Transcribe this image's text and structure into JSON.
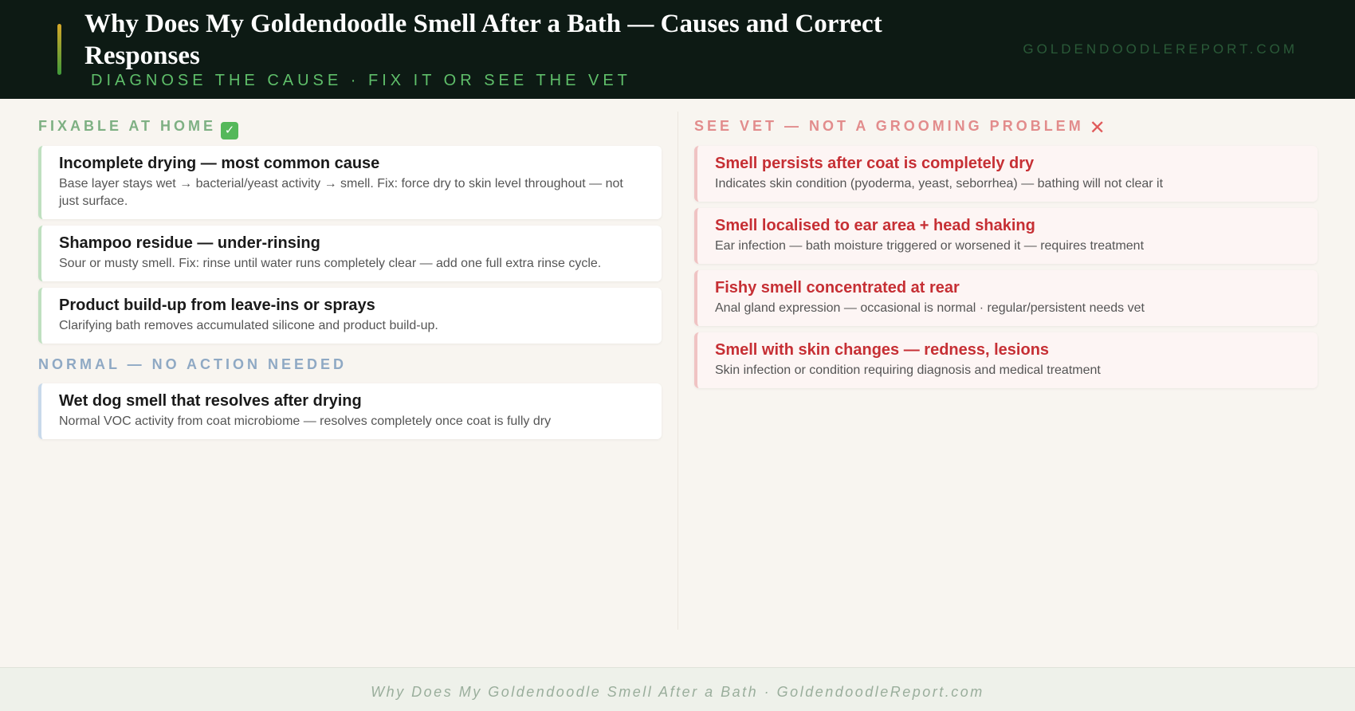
{
  "header": {
    "title": "Why Does My Goldendoodle Smell After a Bath — Causes and Correct Responses",
    "subtitle": "DIAGNOSE THE CAUSE · FIX IT OR SEE THE VET",
    "site": "GOLDENDOODLEREPORT.COM"
  },
  "colors": {
    "header_bg": "#0d1a14",
    "green_accent": "#5fbf6a",
    "fixable_heading": "#7eb083",
    "normal_heading": "#8fa9c4",
    "vet_heading": "#e28c8c",
    "vet_title": "#c62f34"
  },
  "left": {
    "fixable": {
      "heading": "FIXABLE AT HOME",
      "icon": "check-mark-icon",
      "cards": [
        {
          "title": "Incomplete drying — most common cause",
          "desc": "Base layer stays wet → bacterial/yeast activity → smell. Fix: force dry to skin level throughout — not just surface."
        },
        {
          "title": "Shampoo residue — under-rinsing",
          "desc": "Sour or musty smell. Fix: rinse until water runs completely clear — add one full extra rinse cycle."
        },
        {
          "title": "Product build-up from leave-ins or sprays",
          "desc": "Clarifying bath removes accumulated silicone and product build-up."
        }
      ]
    },
    "normal": {
      "heading": "NORMAL — NO ACTION NEEDED",
      "cards": [
        {
          "title": "Wet dog smell that resolves after drying",
          "desc": "Normal VOC activity from coat microbiome — resolves completely once coat is fully dry"
        }
      ]
    }
  },
  "right": {
    "vet": {
      "heading": "SEE VET — NOT A GROOMING PROBLEM",
      "icon": "cross-mark-icon",
      "cards": [
        {
          "title": "Smell persists after coat is completely dry",
          "desc": "Indicates skin condition (pyoderma, yeast, seborrhea) — bathing will not clear it"
        },
        {
          "title": "Smell localised to ear area + head shaking",
          "desc": "Ear infection — bath moisture triggered or worsened it — requires treatment"
        },
        {
          "title": "Fishy smell concentrated at rear",
          "desc": "Anal gland expression — occasional is normal · regular/persistent needs vet"
        },
        {
          "title": "Smell with skin changes — redness, lesions",
          "desc": "Skin infection or condition requiring diagnosis and medical treatment"
        }
      ]
    }
  },
  "footer": {
    "text": "Why Does My Goldendoodle Smell After a Bath · GoldendoodleReport.com"
  }
}
